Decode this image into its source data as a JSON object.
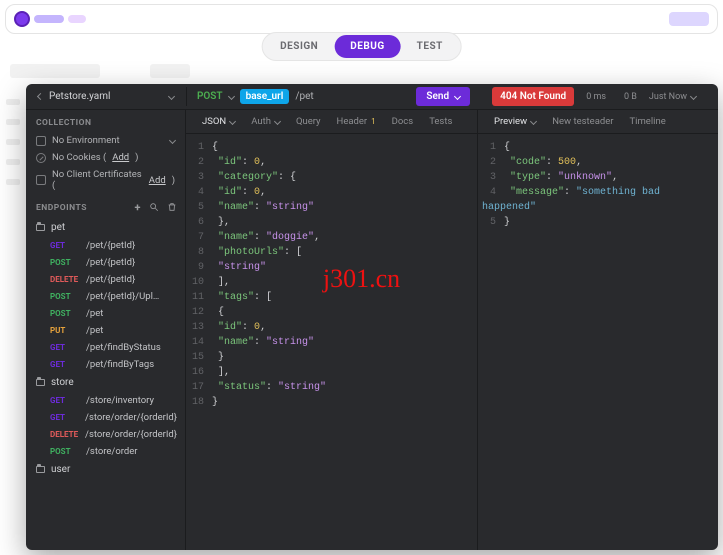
{
  "browser": {},
  "top_tabs": {
    "design": "DESIGN",
    "debug": "DEBUG",
    "test": "TEST"
  },
  "file_name": "Petstore.yaml",
  "request": {
    "method": "POST",
    "base_chip": "base_url",
    "path": "/pet",
    "send_label": "Send",
    "status_badge": "404 Not Found",
    "time": "0 ms",
    "size": "0 B",
    "just_now": "Just Now"
  },
  "sidebar": {
    "collection_head": "COLLECTION",
    "env_row": "No Environment",
    "cookies_prefix": "No Cookies (",
    "cookies_link": "Add",
    "cookies_suffix": ")",
    "certs_prefix": "No Client Certificates (",
    "certs_link": "Add",
    "certs_suffix": ")",
    "endpoints_head": "ENDPOINTS",
    "folders": {
      "pet": "pet",
      "store": "store",
      "user": "user"
    },
    "pet": [
      {
        "m": "GET",
        "p": "/pet/{petId}"
      },
      {
        "m": "POST",
        "p": "/pet/{petId}"
      },
      {
        "m": "DELETE",
        "p": "/pet/{petId}"
      },
      {
        "m": "POST",
        "p": "/pet/{petId}/Upl…"
      },
      {
        "m": "POST",
        "p": "/pet"
      },
      {
        "m": "PUT",
        "p": "/pet"
      },
      {
        "m": "GET",
        "p": "/pet/findByStatus"
      },
      {
        "m": "GET",
        "p": "/pet/findByTags"
      }
    ],
    "store": [
      {
        "m": "GET",
        "p": "/store/inventory"
      },
      {
        "m": "GET",
        "p": "/store/order/{orderId}"
      },
      {
        "m": "DELETE",
        "p": "/store/order/{orderId}"
      },
      {
        "m": "POST",
        "p": "/store/order"
      }
    ]
  },
  "req_tabs": {
    "json": "JSON",
    "auth": "Auth",
    "query": "Query",
    "header": "Header",
    "header_badge": "1",
    "docs": "Docs",
    "tests": "Tests"
  },
  "res_tabs": {
    "preview": "Preview",
    "newtest": "New testeader",
    "timeline": "Timeline"
  },
  "watermark": "j301.cn"
}
